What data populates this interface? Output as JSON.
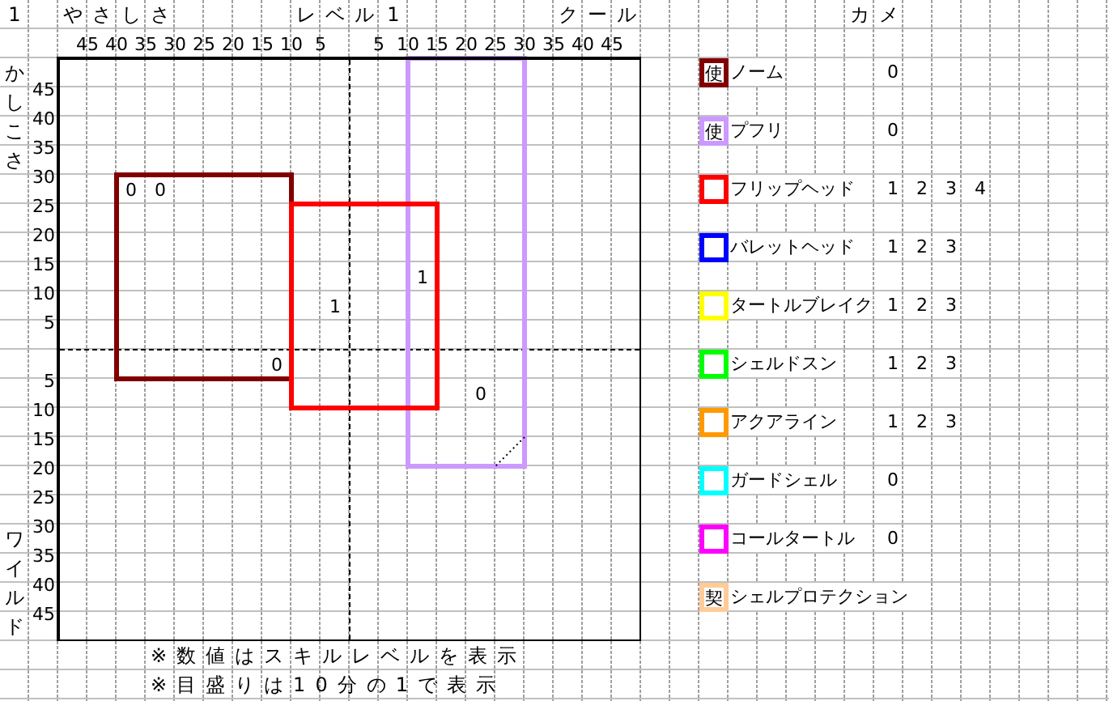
{
  "corner": "1",
  "chart": {
    "x_axis": {
      "left_title": "やさしさ",
      "center_title": "レベル",
      "center_value": "1",
      "right_title": "クール",
      "left_ticks": [
        "45",
        "40",
        "35",
        "30",
        "25",
        "20",
        "15",
        "10",
        "5"
      ],
      "right_ticks": [
        "5",
        "10",
        "15",
        "20",
        "25",
        "30",
        "35",
        "40",
        "45"
      ]
    },
    "y_axis": {
      "upper_title": "かしこさ",
      "lower_title": "ワイルド",
      "upper_ticks": [
        "45",
        "40",
        "35",
        "30",
        "25",
        "20",
        "15",
        "10",
        "5"
      ],
      "lower_ticks": [
        "5",
        "10",
        "15",
        "20",
        "25",
        "30",
        "35",
        "40",
        "45"
      ]
    },
    "regions": [
      {
        "color": "#cc99ff",
        "notch": true
      },
      {
        "color": "#800000",
        "notch": false
      },
      {
        "color": "#ff0000",
        "notch": false
      }
    ],
    "marks": [
      "0",
      "0",
      "1",
      "1",
      "0",
      "0"
    ]
  },
  "legend": {
    "title": "カメ",
    "items": [
      {
        "icon_text": "使",
        "name": "ノーム",
        "color": "#800000",
        "values": [
          "0"
        ]
      },
      {
        "icon_text": "使",
        "name": "プフリ",
        "color": "#cc99ff",
        "values": [
          "0"
        ]
      },
      {
        "name": "フリップヘッド",
        "color": "#ff0000",
        "values": [
          "1",
          "2",
          "3",
          "4"
        ]
      },
      {
        "name": "バレットヘッド",
        "color": "#0000ff",
        "values": [
          "1",
          "2",
          "3"
        ]
      },
      {
        "name": "タートルブレイク",
        "color": "#ffff00",
        "values": [
          "1",
          "2",
          "3"
        ]
      },
      {
        "name": "シェルドスン",
        "color": "#00ff00",
        "values": [
          "1",
          "2",
          "3"
        ]
      },
      {
        "name": "アクアライン",
        "color": "#ff9900",
        "values": [
          "1",
          "2",
          "3"
        ]
      },
      {
        "name": "ガードシェル",
        "color": "#00ffff",
        "values": [
          "0"
        ]
      },
      {
        "name": "コールタートル",
        "color": "#ff00ff",
        "values": [
          "0"
        ]
      },
      {
        "icon_text": "契",
        "name": "シェルプロテクション",
        "color": "#ffcc99"
      }
    ]
  },
  "notes": [
    "※数値はスキルレベルを表示",
    "※目盛りは10分の1で表示"
  ]
}
